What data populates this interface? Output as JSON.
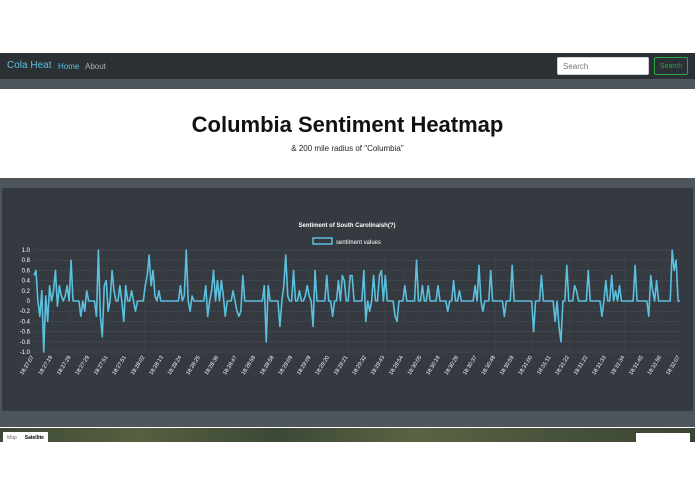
{
  "nav": {
    "brand": "Cola Heat",
    "home": "Home",
    "about": "About",
    "search_placeholder": "Search",
    "search_button": "Search"
  },
  "page": {
    "title": "Columbia Sentiment Heatmap",
    "subtitle": "& 200 mile radius of \"Columbia\""
  },
  "map": {
    "map_tab": "Map",
    "satellite_tab": "Satellite"
  },
  "chart_data": {
    "type": "line",
    "title": "Sentiment of South Carolinaish(?)",
    "series": [
      {
        "name": "sentiment values",
        "color": "#5bc0de",
        "values": [
          0.5,
          0.6,
          0,
          -0.3,
          0.2,
          -1.0,
          0.1,
          -0.4,
          0.3,
          0.0,
          0.2,
          0.6,
          -0.1,
          0.3,
          0.1,
          0.0,
          0.1,
          0.3,
          0.0,
          0.8,
          0.0,
          0.0,
          0.0,
          0.0,
          -0.3,
          0.0,
          -0.2,
          0.2,
          0.0,
          0.0,
          0.0,
          0.0,
          -0.3,
          1.0,
          -0.3,
          -0.7,
          0.3,
          0.4,
          -0.2,
          0.0,
          0.6,
          0.2,
          0.0,
          0.0,
          0.3,
          0.0,
          -0.4,
          0.3,
          0.0,
          0.0,
          0.2,
          0.0,
          -0.2,
          0.0,
          0.0,
          0.0,
          0.0,
          0.3,
          0.5,
          0.9,
          0.3,
          0.6,
          0.1,
          0.0,
          0.2,
          0.0,
          0.0,
          0.0,
          0.0,
          0.0,
          0.0,
          0.0,
          0.0,
          0.0,
          0.0,
          0.3,
          0.0,
          0.1,
          1.0,
          0.0,
          -0.2,
          0.1,
          0.0,
          0.0,
          0.0,
          0.0,
          0.0,
          0.0,
          0.3,
          -0.3,
          0.0,
          0.2,
          0.6,
          0.0,
          0.4,
          0.0,
          0.4,
          0.1,
          -0.3,
          0.0,
          0.0,
          0.0,
          0.2,
          0.0,
          -0.2,
          -0.3,
          -0.2,
          0.5,
          0.0,
          0.0,
          0.0,
          0.0,
          0.0,
          0.0,
          0.0,
          0.0,
          0.0,
          0.0,
          0.3,
          -0.8,
          0.3,
          0.0,
          0.0,
          0.0,
          0.0,
          0.0,
          -0.5,
          0.0,
          0.3,
          0.9,
          0.1,
          0.0,
          0.0,
          0.6,
          0.0,
          0.0,
          0.2,
          0.0,
          0.0,
          0.1,
          0.3,
          0.1,
          0.0,
          -0.5,
          0.6,
          0.0,
          0.0,
          0.0,
          0.0,
          0.0,
          0.5,
          0.0,
          0.0,
          -0.3,
          0.0,
          0.0,
          0.4,
          0.0,
          0.5,
          0.4,
          0.0,
          0.0,
          0.5,
          0.5,
          0.0,
          0.0,
          0.0,
          0.0,
          0.0,
          0.6,
          -0.4,
          0.0,
          -0.2,
          0.0,
          0.5,
          0.0,
          0.0,
          0.5,
          0.6,
          0.0,
          0.5,
          0.0,
          0.0,
          0.0,
          0.0,
          -0.3,
          -0.4,
          0.0,
          0.0,
          0.0,
          0.3,
          0.0,
          0.0,
          0.0,
          0.0,
          0.0,
          0.8,
          0.0,
          0.0,
          0.3,
          0.0,
          0.0,
          0.3,
          0.0,
          0.0,
          0.0,
          0.0,
          0.3,
          0.0,
          0.0,
          0.0,
          0.0,
          -0.2,
          0.0,
          0.0,
          0.4,
          0.0,
          0.0,
          0.2,
          0.0,
          0.0,
          0.0,
          0.0,
          0.0,
          0.0,
          0.0,
          0.3,
          0.0,
          0.7,
          0.0,
          -0.2,
          0.0,
          0.0,
          0.0,
          0.6,
          0.0,
          0.0,
          0.0,
          0.0,
          0.0,
          0.0,
          -0.3,
          0.0,
          0.0,
          0.0,
          0.7,
          0.0,
          0.0,
          0.0,
          0.0,
          0.0,
          0.0,
          0.0,
          0.0,
          0.0,
          0.0,
          -0.6,
          0.0,
          0.0,
          0.0,
          0.5,
          0.0,
          0.0,
          0.0,
          0.0,
          0.0,
          0.0,
          -0.4,
          0.0,
          -0.5,
          -0.8,
          0.0,
          0.0,
          0.7,
          0.0,
          0.0,
          0.0,
          0.3,
          0.2,
          0.0,
          0.0,
          0.0,
          0.0,
          0.0,
          0.6,
          0.0,
          0.0,
          0.0,
          0.0,
          0.0,
          0.0,
          -0.3,
          0.0,
          0.4,
          0.0,
          0.0,
          0.5,
          0.0,
          0.2,
          0.0,
          0.3,
          0.0,
          0.0,
          0.0,
          0.0,
          0.0,
          0.0,
          0.0,
          0.7,
          0.0,
          0.0,
          0.0,
          0.0,
          0.0,
          0.0,
          -0.3,
          0.5,
          0.2,
          0.0,
          0.4,
          0.0,
          0.0,
          0.0,
          0.0,
          0.0,
          0.0,
          0.0,
          1.0,
          0.6,
          0.8,
          0.0,
          0.0
        ]
      }
    ],
    "x_tick_labels": [
      "18:27:07",
      "18:27:18",
      "18:27:29",
      "18:27:29",
      "18:27:51",
      "18:27:51",
      "18:28:02",
      "18:28:13",
      "18:28:24",
      "18:28:25",
      "18:28:36",
      "18:28:47",
      "18:28:58",
      "18:28:58",
      "18:29:09",
      "18:29:09",
      "18:29:20",
      "18:29:21",
      "18:29:32",
      "18:29:43",
      "18:29:54",
      "18:30:05",
      "18:30:16",
      "18:30:26",
      "18:30:37",
      "18:30:48",
      "18:30:59",
      "18:31:00",
      "18:31:11",
      "18:31:22",
      "18:31:22",
      "18:31:33",
      "18:31:34",
      "18:31:45",
      "18:31:56",
      "18:32:07"
    ],
    "y_tick_labels": [
      "1.0",
      "0.8",
      "0.6",
      "0.4",
      "0.2",
      "0",
      "-0.2",
      "-0.4",
      "-0.6",
      "-0.8",
      "-1.0"
    ],
    "ylim": [
      -1.0,
      1.0
    ],
    "grid": true,
    "legend": "top"
  }
}
